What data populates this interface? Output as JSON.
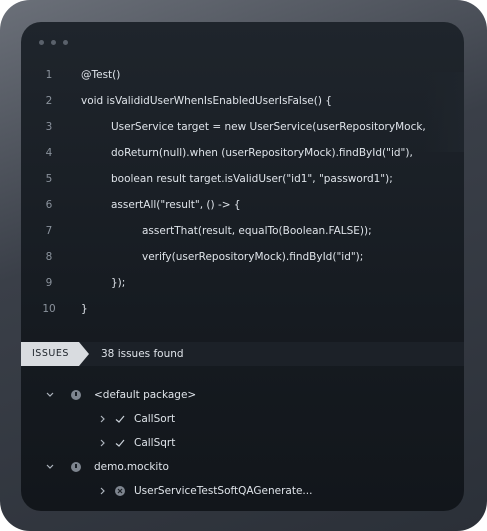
{
  "code": {
    "lines": [
      {
        "num": "1",
        "text": "@Test()"
      },
      {
        "num": "2",
        "text": "void isValididUserWhenIsEnabledUserIsFalse() {"
      },
      {
        "num": "3",
        "text": "UserService target = new UserService(userRepositoryMock,"
      },
      {
        "num": "4",
        "text": "doReturn(null).when (userRepositoryMock).findById(\"id\"),"
      },
      {
        "num": "5",
        "text": "boolean result target.isValidUser(\"id1\", \"password1\");"
      },
      {
        "num": "6",
        "text": "assertAll(\"result\", () -> {"
      },
      {
        "num": "7",
        "text": "assertThat(result, equalTo(Boolean.FALSE));"
      },
      {
        "num": "8",
        "text": "verify(userRepositoryMock).findById(\"id\");"
      },
      {
        "num": "9",
        "text": "});"
      },
      {
        "num": "10",
        "text": "}"
      }
    ]
  },
  "issues": {
    "tab_label": "ISSUES",
    "count_text": "38 issues found"
  },
  "tree": {
    "default_package": "<default package>",
    "call_sort": "CallSort",
    "call_sqrt": "CallSqrt",
    "demo_mockito": "demo.mockito",
    "generated_class": "UserServiceTestSoftQAGenerate..."
  }
}
